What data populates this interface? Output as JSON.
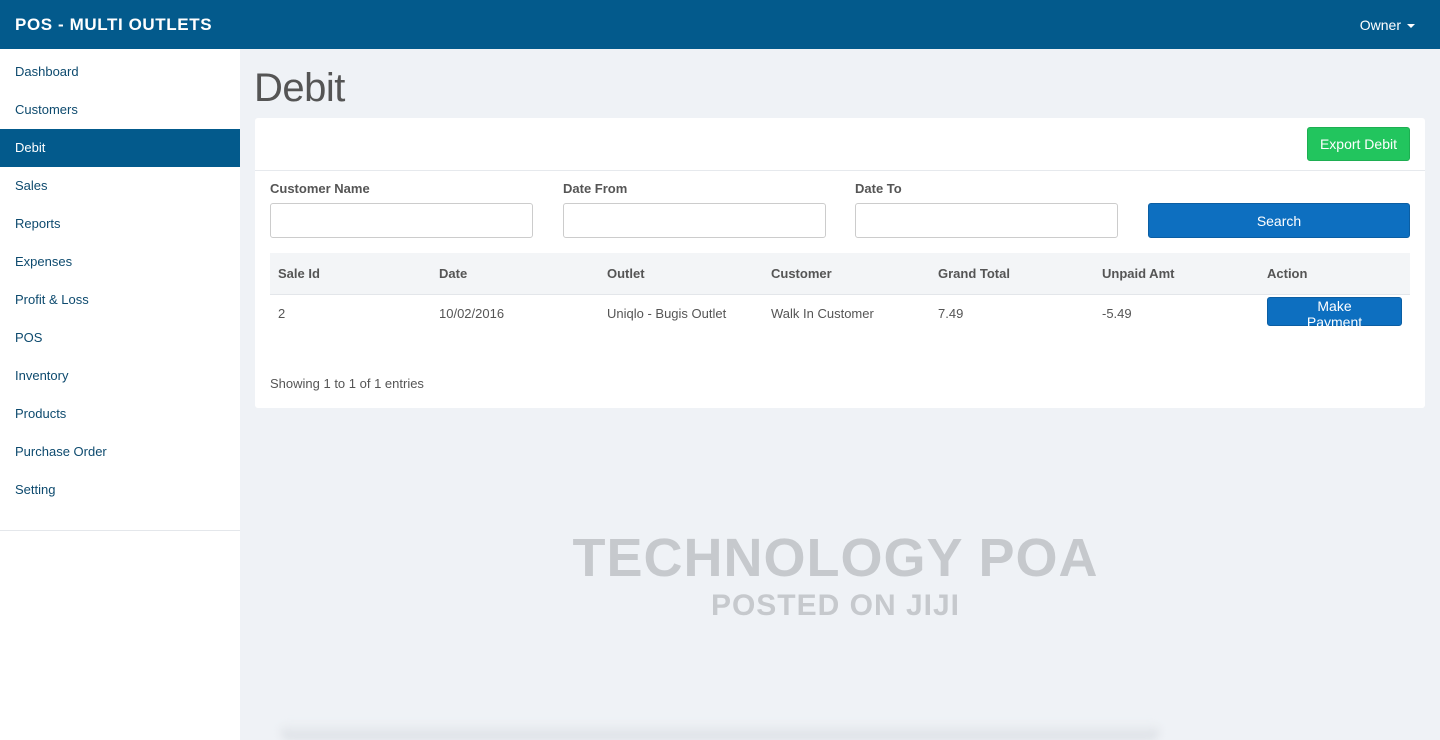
{
  "app": {
    "title": "POS - MULTI OUTLETS",
    "user": "Owner"
  },
  "sidebar": {
    "items": [
      {
        "label": "Dashboard"
      },
      {
        "label": "Customers"
      },
      {
        "label": "Debit"
      },
      {
        "label": "Sales"
      },
      {
        "label": "Reports"
      },
      {
        "label": "Expenses"
      },
      {
        "label": "Profit & Loss"
      },
      {
        "label": "POS"
      },
      {
        "label": "Inventory"
      },
      {
        "label": "Products"
      },
      {
        "label": "Purchase Order"
      },
      {
        "label": "Setting"
      }
    ],
    "active": "Debit"
  },
  "page": {
    "title": "Debit",
    "export_label": "Export Debit"
  },
  "filters": {
    "customer_name": {
      "label": "Customer Name",
      "value": ""
    },
    "date_from": {
      "label": "Date From",
      "value": ""
    },
    "date_to": {
      "label": "Date To",
      "value": ""
    },
    "search_label": "Search"
  },
  "table": {
    "headers": [
      "Sale Id",
      "Date",
      "Outlet",
      "Customer",
      "Grand Total",
      "Unpaid Amt",
      "Action"
    ],
    "rows": [
      {
        "sale_id": "2",
        "date": "10/02/2016",
        "outlet": "Uniqlo - Bugis Outlet",
        "customer": "Walk In Customer",
        "grand_total": "7.49",
        "unpaid_amt": "-5.49",
        "action_label": "Make Payment"
      }
    ],
    "info": "Showing 1 to 1 of 1 entries"
  },
  "watermark": {
    "line1": "TECHNOLOGY POA",
    "line2": "POSTED ON JIJI"
  }
}
